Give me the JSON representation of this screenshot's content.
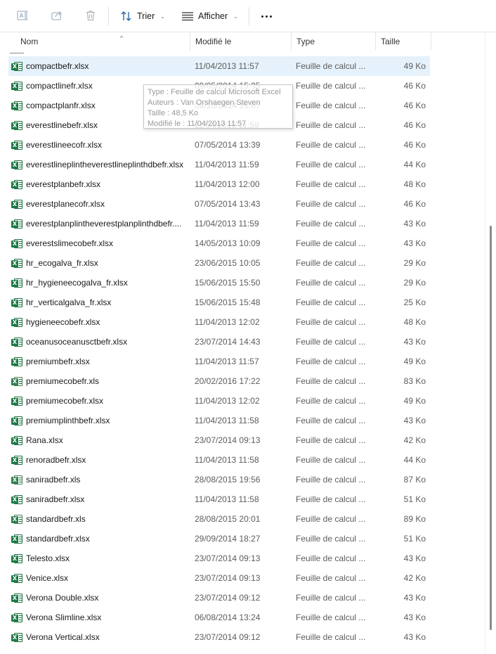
{
  "toolbar": {
    "sort_label": "Trier",
    "view_label": "Afficher",
    "icons": [
      "rename-icon",
      "share-icon",
      "delete-icon",
      "sort-icon",
      "view-icon",
      "more-icon"
    ]
  },
  "columns": {
    "name": "Nom",
    "modified": "Modifié le",
    "type": "Type",
    "size": "Taille"
  },
  "tooltip": {
    "line1": "Type : Feuille de calcul Microsoft Excel",
    "line2": "Auteurs : Van Orshaegen Steven",
    "line3": "Taille : 48,5 Ko",
    "line4": "Modifié le : 11/04/2013 11:57"
  },
  "files": [
    {
      "name": "compactbefr.xlsx",
      "date": "11/04/2013 11:57",
      "type": "Feuille de calcul ...",
      "size": "49 Ko",
      "selected": true
    },
    {
      "name": "compactlinefr.xlsx",
      "date": "09/05/2014 15:35",
      "type": "Feuille de calcul ...",
      "size": "46 Ko"
    },
    {
      "name": "compactplanfr.xlsx",
      "date": "08/10/2014 16:07",
      "type": "Feuille de calcul ...",
      "size": "46 Ko"
    },
    {
      "name": "everestlinebefr.xlsx",
      "date": "11/04/2013 11:59",
      "type": "Feuille de calcul ...",
      "size": "46 Ko"
    },
    {
      "name": "everestlineecofr.xlsx",
      "date": "07/05/2014 13:39",
      "type": "Feuille de calcul ...",
      "size": "46 Ko"
    },
    {
      "name": "everestlineplintheverestlineplinthdbefr.xlsx",
      "date": "11/04/2013 11:59",
      "type": "Feuille de calcul ...",
      "size": "44 Ko"
    },
    {
      "name": "everestplanbefr.xlsx",
      "date": "11/04/2013 12:00",
      "type": "Feuille de calcul ...",
      "size": "48 Ko"
    },
    {
      "name": "everestplanecofr.xlsx",
      "date": "07/05/2014 13:43",
      "type": "Feuille de calcul ...",
      "size": "46 Ko"
    },
    {
      "name": "everestplanplintheverestplanplinthdbefr....",
      "date": "11/04/2013 11:59",
      "type": "Feuille de calcul ...",
      "size": "43 Ko"
    },
    {
      "name": "everestslimecobefr.xlsx",
      "date": "14/05/2013 10:09",
      "type": "Feuille de calcul ...",
      "size": "43 Ko"
    },
    {
      "name": "hr_ecogalva_fr.xlsx",
      "date": "23/06/2015 10:05",
      "type": "Feuille de calcul ...",
      "size": "29 Ko"
    },
    {
      "name": "hr_hygieneecogalva_fr.xlsx",
      "date": "15/06/2015 15:50",
      "type": "Feuille de calcul ...",
      "size": "29 Ko"
    },
    {
      "name": "hr_verticalgalva_fr.xlsx",
      "date": "15/06/2015 15:48",
      "type": "Feuille de calcul ...",
      "size": "25 Ko"
    },
    {
      "name": "hygieneecobefr.xlsx",
      "date": "11/04/2013 12:02",
      "type": "Feuille de calcul ...",
      "size": "48 Ko"
    },
    {
      "name": "oceanusoceanusctbefr.xlsx",
      "date": "23/07/2014 14:43",
      "type": "Feuille de calcul ...",
      "size": "43 Ko"
    },
    {
      "name": "premiumbefr.xlsx",
      "date": "11/04/2013 11:57",
      "type": "Feuille de calcul ...",
      "size": "49 Ko"
    },
    {
      "name": "premiumecobefr.xls",
      "date": "20/02/2016 17:22",
      "type": "Feuille de calcul ...",
      "size": "83 Ko",
      "legacy": true
    },
    {
      "name": "premiumecobefr.xlsx",
      "date": "11/04/2013 12:02",
      "type": "Feuille de calcul ...",
      "size": "49 Ko"
    },
    {
      "name": "premiumplinthbefr.xlsx",
      "date": "11/04/2013 11:58",
      "type": "Feuille de calcul ...",
      "size": "43 Ko"
    },
    {
      "name": "Rana.xlsx",
      "date": "23/07/2014 09:13",
      "type": "Feuille de calcul ...",
      "size": "42 Ko"
    },
    {
      "name": "renoradbefr.xlsx",
      "date": "11/04/2013 11:58",
      "type": "Feuille de calcul ...",
      "size": "44 Ko"
    },
    {
      "name": "saniradbefr.xls",
      "date": "28/08/2015 19:56",
      "type": "Feuille de calcul ...",
      "size": "87 Ko",
      "legacy": true
    },
    {
      "name": "saniradbefr.xlsx",
      "date": "11/04/2013 11:58",
      "type": "Feuille de calcul ...",
      "size": "51 Ko"
    },
    {
      "name": "standardbefr.xls",
      "date": "28/08/2015 20:01",
      "type": "Feuille de calcul ...",
      "size": "89 Ko",
      "legacy": true
    },
    {
      "name": "standardbefr.xlsx",
      "date": "29/09/2014 18:27",
      "type": "Feuille de calcul ...",
      "size": "51 Ko"
    },
    {
      "name": "Telesto.xlsx",
      "date": "23/07/2014 09:13",
      "type": "Feuille de calcul ...",
      "size": "43 Ko"
    },
    {
      "name": "Venice.xlsx",
      "date": "23/07/2014 09:13",
      "type": "Feuille de calcul ...",
      "size": "42 Ko"
    },
    {
      "name": "Verona Double.xlsx",
      "date": "23/07/2014 09:12",
      "type": "Feuille de calcul ...",
      "size": "43 Ko"
    },
    {
      "name": "Verona Slimline.xlsx",
      "date": "06/08/2014 13:24",
      "type": "Feuille de calcul ...",
      "size": "43 Ko"
    },
    {
      "name": "Verona Vertical.xlsx",
      "date": "23/07/2014 09:12",
      "type": "Feuille de calcul ...",
      "size": "43 Ko"
    }
  ],
  "colors": {
    "selection": "#e5f1fb",
    "excel_green": "#1d7a45",
    "secondary_text": "#5c5c5c"
  }
}
